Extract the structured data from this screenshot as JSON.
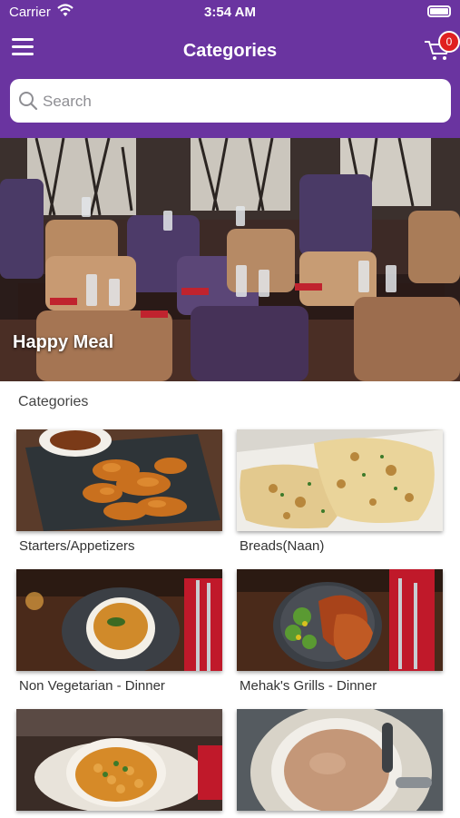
{
  "status_bar": {
    "carrier": "Carrier",
    "time": "3:54 AM"
  },
  "header": {
    "title": "Categories",
    "cart_count": "0"
  },
  "search": {
    "placeholder": "Search"
  },
  "banner": {
    "label": "Happy Meal"
  },
  "section": {
    "title": "Categories"
  },
  "categories": [
    {
      "label": "Starters/Appetizers"
    },
    {
      "label": "Breads(Naan)"
    },
    {
      "label": "Non Vegetarian - Dinner"
    },
    {
      "label": "Mehak's Grills - Dinner"
    },
    {
      "label": ""
    },
    {
      "label": ""
    }
  ],
  "colors": {
    "brand": "#6a34a0",
    "badge": "#e02020"
  }
}
